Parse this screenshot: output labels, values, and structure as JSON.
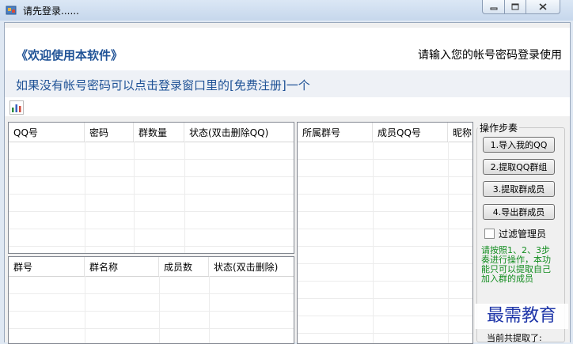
{
  "window": {
    "title": "请先登录......"
  },
  "banner": {
    "welcome": "《欢迎使用本软件》",
    "login_hint": "请输入您的帐号密码登录使用",
    "register_hint": "如果没有帐号密码可以点击登录窗口里的[免费注册]一个"
  },
  "accounts_grid": {
    "columns": [
      "QQ号",
      "密码",
      "群数量",
      "状态(双击删除QQ)"
    ]
  },
  "groups_grid": {
    "columns": [
      "群号",
      "群名称",
      "成员数",
      "状态(双击删除)"
    ]
  },
  "members_grid": {
    "columns": [
      "所属群号",
      "成员QQ号",
      "昵称"
    ]
  },
  "steps": {
    "legend": "操作步奏",
    "buttons": [
      "1.导入我的QQ",
      "2.提取QQ群组",
      "3.提取群成员",
      "4.导出群成员"
    ],
    "filter_admins_label": "过滤管理员",
    "instructions": "请按照1、2、3步奏进行操作，本功能只可以提取自己加入群的成员",
    "status_partial": "当前共提取了:"
  },
  "watermark": "最需教育",
  "colors": {
    "accent_blue": "#1f5296",
    "note_green": "#118c1e",
    "watermark": "#1e35a8"
  }
}
